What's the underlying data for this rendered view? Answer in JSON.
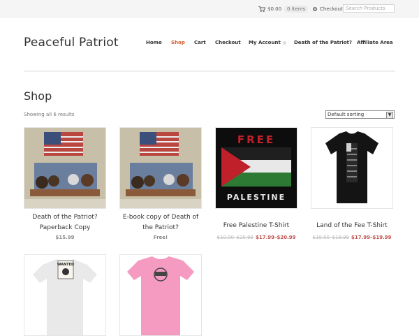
{
  "topbar": {
    "cart_total": "$0.00",
    "cart_items": "0 items",
    "checkout": "Checkout",
    "search_placeholder": "Search Products"
  },
  "site": {
    "title": "Peaceful Patriot"
  },
  "nav": {
    "items": [
      {
        "label": "Home"
      },
      {
        "label": "Shop"
      },
      {
        "label": "Cart"
      },
      {
        "label": "Checkout"
      },
      {
        "label": "My Account"
      },
      {
        "label": "Death of the Patriot?"
      },
      {
        "label": "Affiliate Area"
      }
    ],
    "active": "Shop"
  },
  "page": {
    "title": "Shop",
    "result_count": "Showing all 6 results",
    "sort_selected": "Default sorting"
  },
  "products": [
    {
      "name": "Death of the Patriot? Paperback Copy",
      "price": "$15.99",
      "old_price": ""
    },
    {
      "name": "E-book copy of Death of the Patriot?",
      "price": "Free!",
      "old_price": ""
    },
    {
      "name": "Free Palestine T-Shirt",
      "price": "$17.99–$20.99",
      "old_price": "$10.00–$20.99",
      "image_text_top": "FREE",
      "image_text_bottom": "PALESTINE"
    },
    {
      "name": "Land of the Fee T-Shirt",
      "price": "$17.99–$19.99",
      "old_price": "$10.00–$19.99"
    },
    {
      "name": "",
      "price": "",
      "old_price": "",
      "image_text_top": "WANTED"
    },
    {
      "name": "",
      "price": "",
      "old_price": ""
    }
  ],
  "colors": {
    "accent": "#d35a2a",
    "sale_price": "#c0504d",
    "topbar_bg": "#f5f5f5",
    "pink_shirt": "#f59ac0"
  }
}
